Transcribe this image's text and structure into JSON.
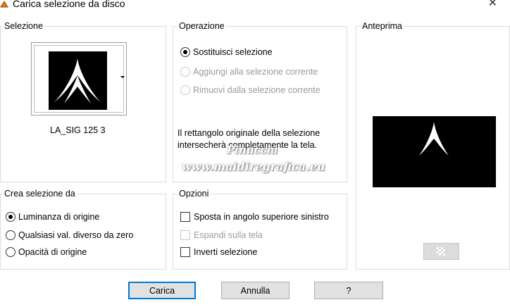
{
  "window": {
    "title": "Carica selezione da disco"
  },
  "selezione": {
    "label": "Selezione",
    "file_name": "LA_SIG 125 3"
  },
  "operazione": {
    "label": "Operazione",
    "options": [
      {
        "label": "Sostituisci selezione",
        "checked": true,
        "enabled": true
      },
      {
        "label": "Aggiungi alla selezione corrente",
        "checked": false,
        "enabled": false
      },
      {
        "label": "Rimuovi dalla selezione corrente",
        "checked": false,
        "enabled": false
      }
    ],
    "info_line1": "Il rettangolo originale della selezione",
    "info_line2": "intersecherà completamente la tela."
  },
  "anteprima": {
    "label": "Anteprima"
  },
  "crea": {
    "label": "Crea selezione da",
    "options": [
      {
        "label": "Luminanza di origine",
        "checked": true
      },
      {
        "label": "Qualsiasi val. diverso da zero",
        "checked": false
      },
      {
        "label": "Opacità di origine",
        "checked": false
      }
    ]
  },
  "opzioni": {
    "label": "Opzioni",
    "options": [
      {
        "label": "Sposta in angolo superiore sinistro",
        "checked": false,
        "enabled": true
      },
      {
        "label": "Espandi sulla tela",
        "checked": false,
        "enabled": false
      },
      {
        "label": "Inverti selezione",
        "checked": false,
        "enabled": true
      }
    ]
  },
  "buttons": {
    "load": "Carica",
    "cancel": "Annulla",
    "help": "?"
  },
  "watermark": {
    "line1": "Pinuccia",
    "line2": "www.maidiregrafica.eu"
  },
  "colors": {
    "default_button_border": "#0078d7",
    "button_bg": "#e1e1e1",
    "group_border": "#dcdcdc",
    "disabled_text": "#9a9a9a"
  },
  "icons": {
    "title_bar": "app-icon",
    "window_close": "close-icon",
    "thumbnail_dropdown": "dropdown-arrow-icon",
    "preview_zoom": "checkerboard-icon"
  }
}
